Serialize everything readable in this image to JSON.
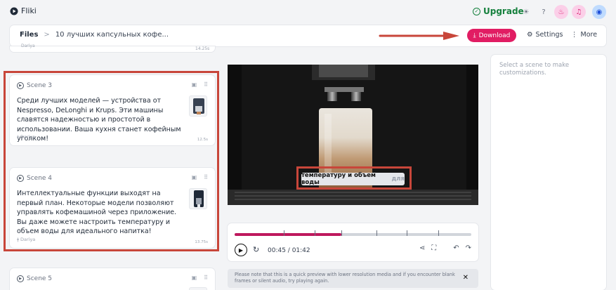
{
  "app": {
    "name": "Fliki"
  },
  "topbar": {
    "upgrade_label": "Upgrade"
  },
  "header": {
    "breadcrumb_root": "Files",
    "breadcrumb_sep": ">",
    "breadcrumb_title": "10 лучших капсульных кофе...",
    "download_label": "Download",
    "settings_label": "Settings",
    "more_label": "More"
  },
  "scenes": {
    "previous": {
      "voice": "Dariya",
      "duration": "14.25s"
    },
    "items": [
      {
        "label": "Scene 3",
        "text": "Среди лучших моделей — устройства от Nespresso, DeLonghi и Krups. Эти машины славятся надежностью и простотой в использовании. Ваша кухня станет кофейным уголком!",
        "voice": "Dariya",
        "duration": "12.5s"
      },
      {
        "label": "Scene 4",
        "text": "Интеллектуальные функции выходят на первый план. Некоторые модели позволяют управлять кофемашиной через приложение. Вы даже можете настроить температуру и объем воды для идеального напитка!",
        "voice": "Dariya",
        "duration": "13.75s"
      },
      {
        "label": "Scene 5"
      }
    ]
  },
  "video": {
    "subtitle_main": "температуру и объем воды",
    "subtitle_next": "для"
  },
  "player": {
    "time": "00:45 / 01:42",
    "progress": 0.45
  },
  "notice": {
    "text": "Please note that this is a quick preview with lower resolution media and if you encounter blank frames or silent audio, try playing again."
  },
  "right_panel": {
    "hint": "Select a scene to make customizations."
  },
  "colors": {
    "accent": "#e11d63",
    "upgrade": "#15803d",
    "annotation": "#c8463a"
  }
}
